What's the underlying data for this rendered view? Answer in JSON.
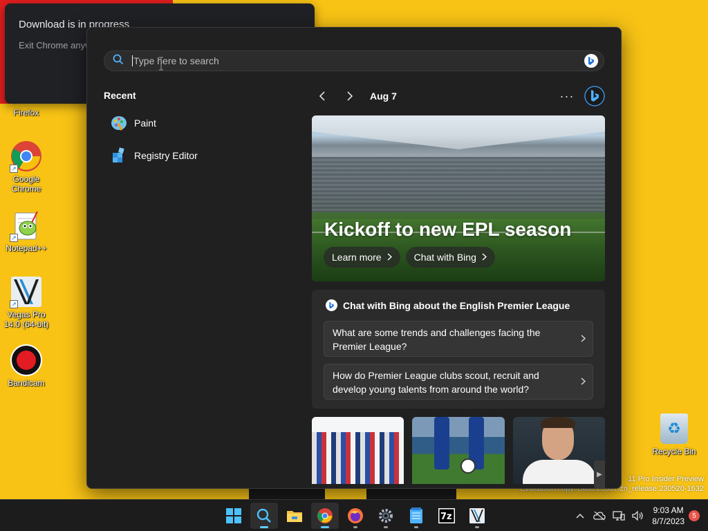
{
  "colors": {
    "desktop_yellow": "#f8c315",
    "panel_bg": "#202020",
    "taskbar_bg": "#1c1c1c",
    "accent": "#60cdff",
    "notification_badge": "#e8544c"
  },
  "desktop": {
    "icons": [
      {
        "label": "Firefox",
        "icon": "firefox-icon"
      },
      {
        "label": "Google Chrome",
        "icon": "chrome-icon"
      },
      {
        "label": "Notepad++",
        "icon": "notepadpp-icon"
      },
      {
        "label": "Vegas Pro 14.0 (64-bit)",
        "icon": "vegas-icon"
      },
      {
        "label": "Bandicam",
        "icon": "bandicam-icon"
      }
    ],
    "recycle_bin": {
      "label": "Recycle Bin",
      "icon": "recycle-bin-icon"
    },
    "watermark": {
      "line1": "11 Pro Insider Preview",
      "line2": "Evaluation copy. Build 23537.zn_release.230520-1632"
    }
  },
  "toast": {
    "title": "Download is in progress",
    "body": "Exit Chrome anyway"
  },
  "search": {
    "placeholder": "Type here to search",
    "value": "",
    "recent": {
      "title": "Recent",
      "items": [
        {
          "label": "Paint",
          "icon": "paint-icon"
        },
        {
          "label": "Registry Editor",
          "icon": "registry-editor-icon"
        }
      ]
    },
    "highlights": {
      "date": "Aug 7",
      "more_label": "···",
      "hero": {
        "title": "Kickoff to new EPL season",
        "buttons": [
          "Learn more",
          "Chat with Bing"
        ]
      },
      "chat": {
        "header": "Chat with Bing about the English Premier League",
        "questions": [
          {
            "line1": "What are some trends and challenges facing the",
            "line2": "Premier League?"
          },
          {
            "line1": "How do Premier League clubs scout, recruit and",
            "line2": "develop young talents from around the world?"
          }
        ]
      },
      "thumbnails": [
        "jerseys-thumbnail",
        "football-boots-thumbnail",
        "player-portrait-thumbnail"
      ]
    }
  },
  "taskbar": {
    "apps": [
      {
        "name": "start-button",
        "icon": "windows-icon",
        "state": "none"
      },
      {
        "name": "search-button",
        "icon": "search-icon",
        "state": "active"
      },
      {
        "name": "file-explorer-button",
        "icon": "folder-icon",
        "state": "none"
      },
      {
        "name": "chrome-button",
        "icon": "chrome-icon",
        "state": "running-active"
      },
      {
        "name": "firefox-button",
        "icon": "firefox-icon",
        "state": "running"
      },
      {
        "name": "settings-button",
        "icon": "gear-icon",
        "state": "running"
      },
      {
        "name": "notepad-button",
        "icon": "notepad-icon",
        "state": "running"
      },
      {
        "name": "7zip-button",
        "icon": "7zip-icon",
        "state": "none"
      },
      {
        "name": "vegas-button",
        "icon": "vegas-icon",
        "state": "running"
      }
    ],
    "clock": {
      "time": "9:03 AM",
      "date": "8/7/2023"
    },
    "notification_count": "5"
  }
}
